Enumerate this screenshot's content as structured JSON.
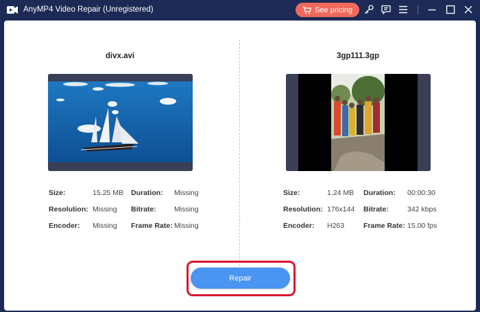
{
  "window": {
    "title": "AnyMP4 Video Repair (Unregistered)",
    "pricing_label": "See pricing"
  },
  "colors": {
    "titlebar": "#1c2a55",
    "pricing_button": "#f06a5c",
    "repair_button": "#4a94f2",
    "highlight_outline": "#d9182d"
  },
  "left_file": {
    "name": "divx.avi",
    "size_label": "Size:",
    "size": "15.25 MB",
    "duration_label": "Duration:",
    "duration": "Missing",
    "resolution_label": "Resolution:",
    "resolution": "Missing",
    "bitrate_label": "Bitrate:",
    "bitrate": "Missing",
    "encoder_label": "Encoder:",
    "encoder": "Missing",
    "framerate_label": "Frame Rate:",
    "framerate": "Missing"
  },
  "right_file": {
    "name": "3gp111.3gp",
    "size_label": "Size:",
    "size": "1.24 MB",
    "duration_label": "Duration:",
    "duration": "00:00:30",
    "resolution_label": "Resolution:",
    "resolution": "176x144",
    "bitrate_label": "Bitrate:",
    "bitrate": "342 kbps",
    "encoder_label": "Encoder:",
    "encoder": "H263",
    "framerate_label": "Frame Rate:",
    "framerate": "15.00 fps"
  },
  "repair_label": "Repair",
  "icons": [
    "app-logo-icon",
    "cart-icon",
    "key-icon",
    "feedback-icon",
    "menu-icon",
    "minimize-icon",
    "maximize-icon",
    "close-icon"
  ]
}
